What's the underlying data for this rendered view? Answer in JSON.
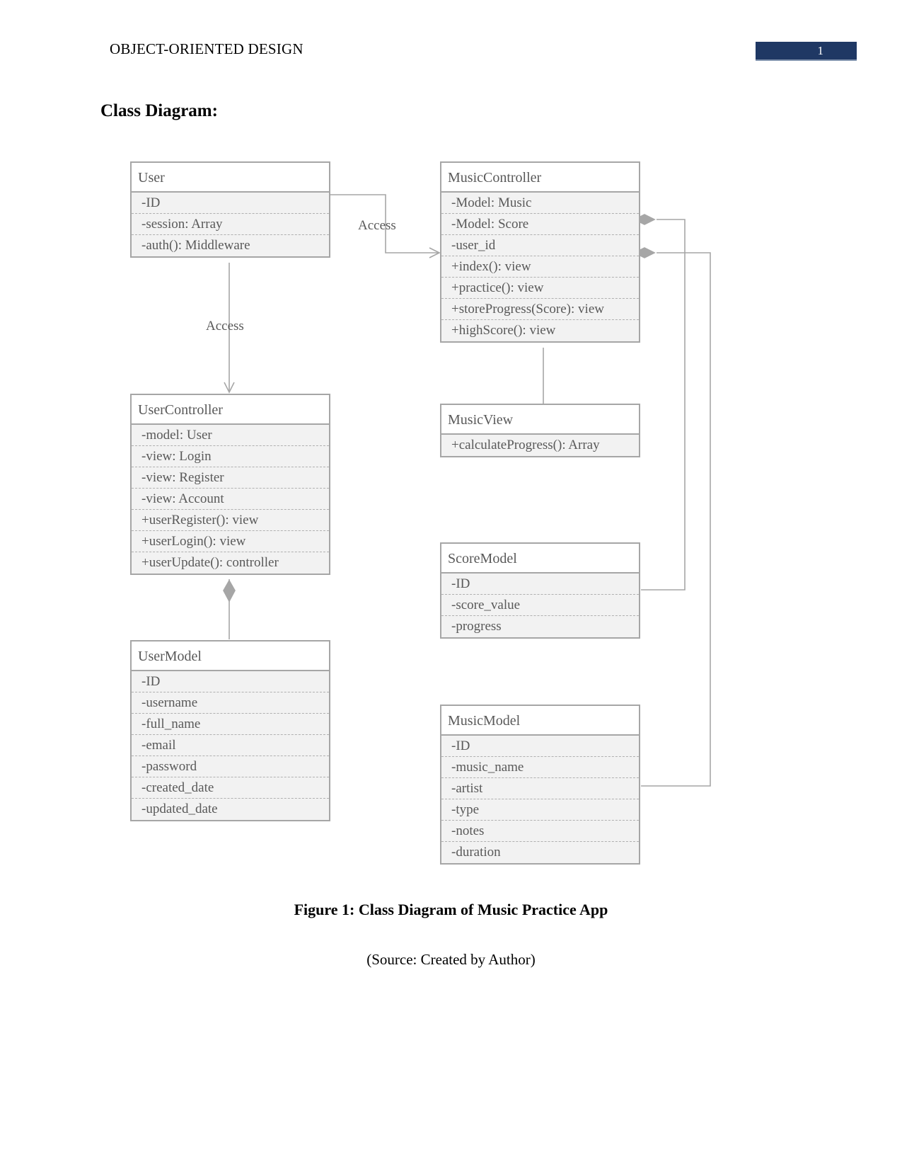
{
  "header": {
    "running_head": "OBJECT-ORIENTED DESIGN",
    "page_number": "1",
    "badge_color": "#1F3864"
  },
  "section": {
    "title": "Class Diagram:"
  },
  "diagram": {
    "classes": [
      {
        "id": "user",
        "name": "User",
        "members": [
          "-ID",
          "-session: Array",
          "-auth(): Middleware"
        ]
      },
      {
        "id": "music-controller",
        "name": "MusicController",
        "members": [
          "-Model: Music",
          "-Model: Score",
          "-user_id",
          "+index(): view",
          "+practice(): view",
          "+storeProgress(Score):  view",
          "+highScore(): view"
        ]
      },
      {
        "id": "user-controller",
        "name": "UserController",
        "members": [
          "-model: User",
          "-view: Login",
          "-view: Register",
          "-view: Account",
          "+userRegister(): view",
          "+userLogin(): view",
          "+userUpdate(): controller"
        ]
      },
      {
        "id": "music-view",
        "name": "MusicView",
        "members": [
          "+calculateProgress(): Array"
        ]
      },
      {
        "id": "score-model",
        "name": "ScoreModel",
        "members": [
          "-ID",
          "-score_value",
          "-progress"
        ]
      },
      {
        "id": "user-model",
        "name": "UserModel",
        "members": [
          "-ID",
          "-username",
          "-full_name",
          "-email",
          "-password",
          "-created_date",
          "-updated_date"
        ]
      },
      {
        "id": "music-model",
        "name": "MusicModel",
        "members": [
          "-ID",
          "-music_name",
          "-artist",
          "-type",
          "-notes",
          "-duration"
        ]
      }
    ],
    "edge_labels": [
      {
        "id": "user-to-musiccontroller",
        "text": "Access"
      },
      {
        "id": "user-to-usercontroller",
        "text": "Access"
      }
    ],
    "line_color": "#a6a6a6",
    "fill_color": "#f2f2f2",
    "text_color": "#595959"
  },
  "caption": {
    "figure": "Figure 1: Class Diagram of Music Practice App",
    "source": "(Source: Created by Author)"
  }
}
